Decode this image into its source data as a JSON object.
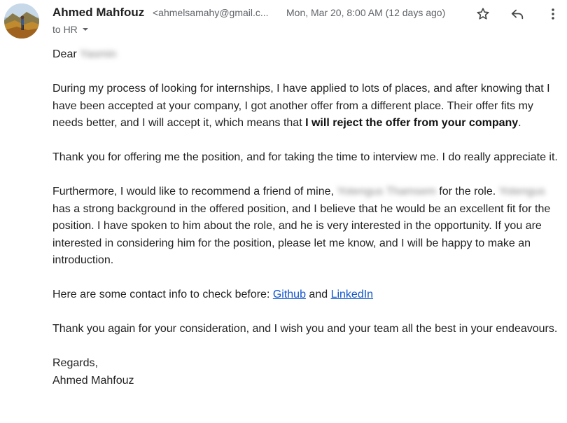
{
  "sender": {
    "name": "Ahmed Mahfouz",
    "email": "<ahmelsamahy@gmail.c...",
    "date": "Mon, Mar 20, 8:00 AM (12 days ago)"
  },
  "recipient": {
    "label": "to HR"
  },
  "icons": {
    "star": "star-icon",
    "reply": "reply-icon",
    "more": "more-vert-icon",
    "dropdown": "caret-down-icon"
  },
  "body": {
    "greeting_prefix": "Dear",
    "greeting_name_redacted": "Yasmin",
    "p1_text": "During my process of looking for internships, I have applied to lots of places, and after knowing that I have been accepted at your company, I got another offer from a different place. Their offer fits my needs better, and I will accept it, which means that ",
    "p1_bold": "I will reject the offer from your company",
    "p1_end": ".",
    "p2": "Thank you for offering me the position, and for taking the time to interview me. I do really appreciate it.",
    "p3_start": "Furthermore, I would like to recommend a friend of mine, ",
    "p3_redacted_full": "Yotengus Thamsem",
    "p3_mid": " for the role. ",
    "p3_redacted_first": "Yotengus",
    "p3_end": " has a strong background in the offered position, and I believe that he would be an excellent fit for the position. I have spoken to him about the role, and he is very interested in the opportunity. If you are interested in considering him for the position, please let me know, and I will be happy to make an introduction.",
    "p4_start": "Here are some contact info to check before: ",
    "link_github": "Github",
    "p4_and": " and ",
    "link_linkedin": "LinkedIn",
    "p5": "Thank you again for your consideration, and I wish you and your team all the best in your endeavours.",
    "regards": "Regards,",
    "signature": "Ahmed Mahfouz"
  },
  "colors": {
    "text": "#222222",
    "secondary": "#5f6368",
    "link": "#1155cc"
  }
}
